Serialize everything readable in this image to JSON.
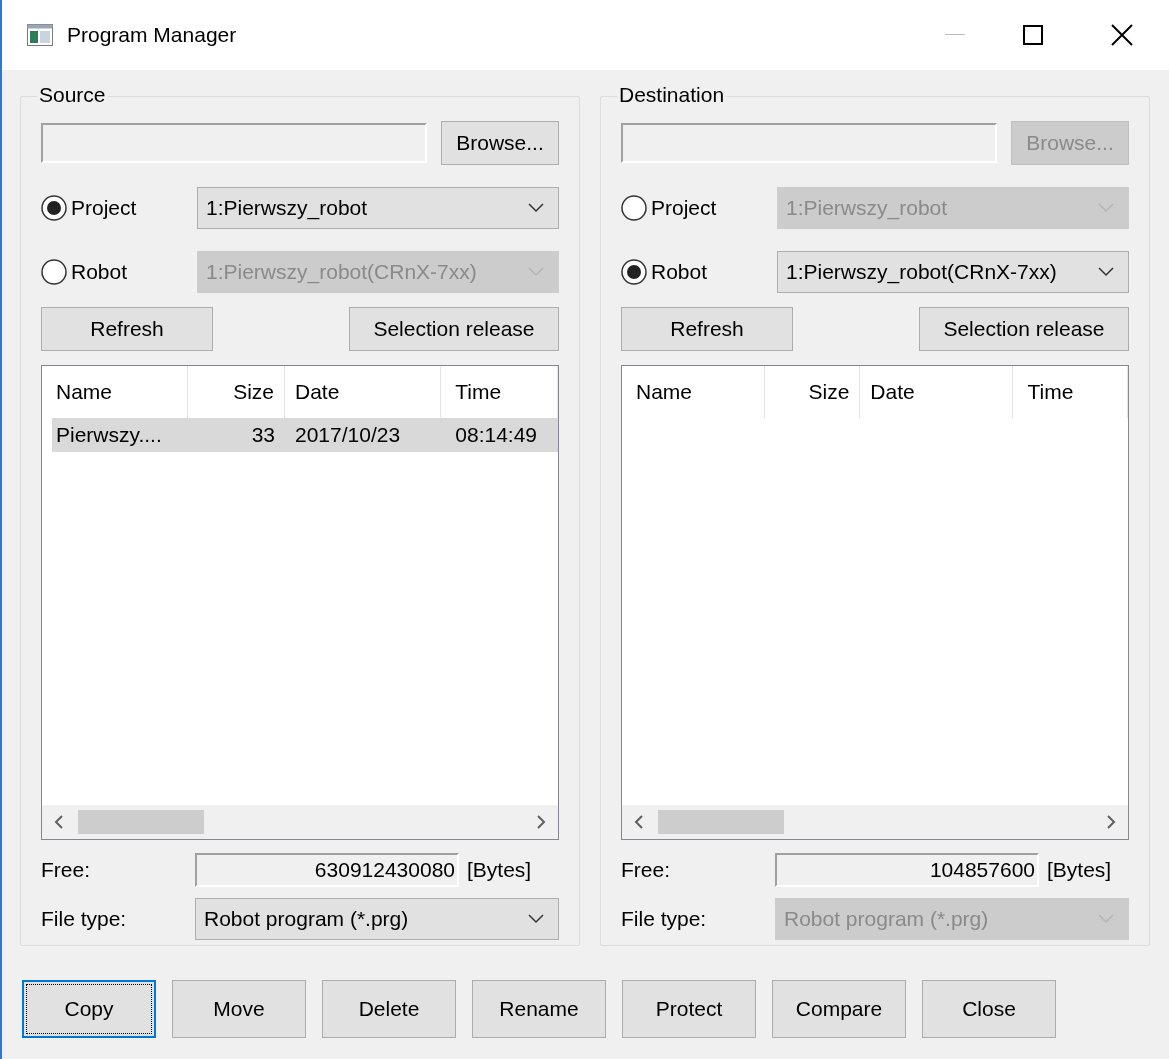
{
  "window": {
    "title": "Program Manager"
  },
  "panels": [
    {
      "title": "Source",
      "path": {
        "disabled": false
      },
      "browse": {
        "label": "Browse...",
        "disabled": false
      },
      "options": [
        {
          "label": "Project",
          "selected": true,
          "combo": "1:Pierwszy_robot"
        },
        {
          "label": "Robot",
          "selected": false,
          "combo": "1:Pierwszy_robot(CRnX-7xx)"
        }
      ],
      "refresh": "Refresh",
      "selection_release": "Selection release",
      "table": {
        "columns": [
          "Name",
          "Size",
          "Date",
          "Time"
        ],
        "rows": [
          {
            "cells": [
              "Pierwszy....",
              "33",
              "2017/10/23",
              "08:14:49"
            ],
            "selected": true
          }
        ]
      },
      "free_label": "Free:",
      "free_value": "630912430080",
      "free_unit": "[Bytes]",
      "file_type_label": "File type:",
      "file_type": {
        "value": "Robot program (*.prg)",
        "disabled": false
      }
    },
    {
      "title": "Destination",
      "path": {
        "disabled": false
      },
      "browse": {
        "label": "Browse...",
        "disabled": true
      },
      "options": [
        {
          "label": "Project",
          "selected": false,
          "combo": "1:Pierwszy_robot"
        },
        {
          "label": "Robot",
          "selected": true,
          "combo": "1:Pierwszy_robot(CRnX-7xx)"
        }
      ],
      "refresh": "Refresh",
      "selection_release": "Selection release",
      "table": {
        "columns": [
          "Name",
          "Size",
          "Date",
          "Time"
        ]
      },
      "free_label": "Free:",
      "free_value": "104857600",
      "free_unit": "[Bytes]",
      "file_type_label": "File type:",
      "file_type": {
        "value": "Robot program (*.prg)",
        "disabled": true
      }
    }
  ],
  "buttons": [
    {
      "label": "Copy",
      "focused": true
    },
    {
      "label": "Move",
      "focused": false
    },
    {
      "label": "Delete",
      "focused": false
    },
    {
      "label": "Rename",
      "focused": false
    },
    {
      "label": "Protect",
      "focused": false
    },
    {
      "label": "Compare",
      "focused": false
    },
    {
      "label": "Close",
      "focused": false
    }
  ]
}
